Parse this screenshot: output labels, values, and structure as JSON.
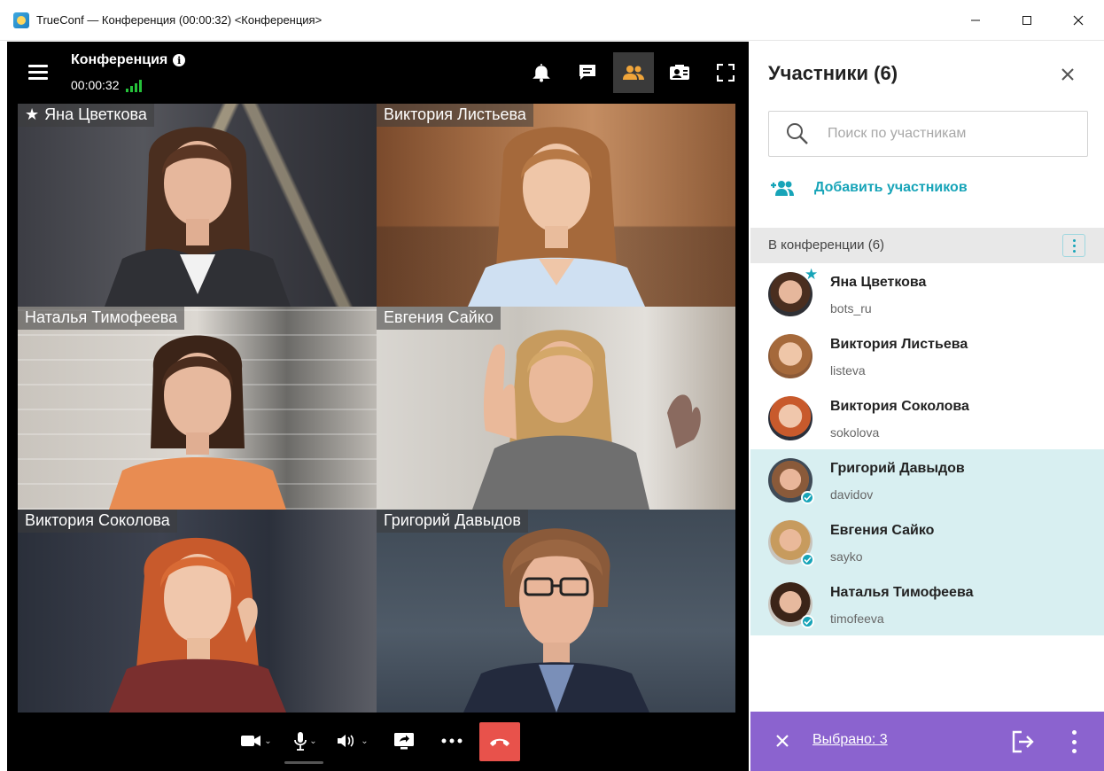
{
  "window": {
    "title": "TrueConf — Конференция (00:00:32) <Конференция>",
    "controls": [
      "minimize",
      "maximize",
      "close"
    ]
  },
  "conference": {
    "title": "Конференция",
    "timer": "00:00:32",
    "signal_color": "#25c13a"
  },
  "toolbar": {
    "icons": [
      "bell-icon",
      "chat-icon",
      "participants-icon",
      "contact-card-icon",
      "fullscreen-icon"
    ],
    "active": "participants-icon"
  },
  "video_tiles": [
    {
      "name": "Яна Цветкова",
      "owner": true
    },
    {
      "name": "Виктория Листьева",
      "owner": false
    },
    {
      "name": "Наталья Тимофеева",
      "owner": false
    },
    {
      "name": "Евгения Сайко",
      "owner": false
    },
    {
      "name": "Виктория Соколова",
      "owner": false
    },
    {
      "name": "Григорий Давыдов",
      "owner": false
    }
  ],
  "controls_bar": {
    "items": [
      "camera-icon",
      "microphone-icon",
      "speaker-icon",
      "share-screen-icon",
      "more-icon",
      "hangup-icon"
    ],
    "hangup_color": "#e8524b"
  },
  "participants_panel": {
    "title": "Участники (6)",
    "search_placeholder": "Поиск по участникам",
    "add_label": "Добавить участников",
    "section_title": "В конференции (6)",
    "accent_color": "#17a4b8",
    "participants": [
      {
        "name": "Яна Цветкова",
        "login": "bots_ru",
        "selected": false,
        "owner": true
      },
      {
        "name": "Виктория Листьева",
        "login": "listeva",
        "selected": false,
        "owner": false
      },
      {
        "name": "Виктория Соколова",
        "login": "sokolova",
        "selected": false,
        "owner": false
      },
      {
        "name": "Григорий Давыдов",
        "login": "davidov",
        "selected": true,
        "owner": false
      },
      {
        "name": "Евгения Сайко",
        "login": "sayko",
        "selected": true,
        "owner": false
      },
      {
        "name": "Наталья Тимофеева",
        "login": "timofeeva",
        "selected": true,
        "owner": false
      }
    ],
    "footer": {
      "selected_label": "Выбрано: 3",
      "color": "#8b63cf"
    }
  }
}
